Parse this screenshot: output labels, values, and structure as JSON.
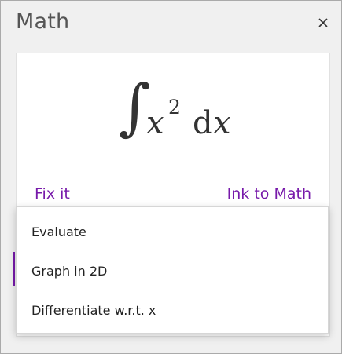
{
  "pane": {
    "title": "Math",
    "close_icon": "close-icon"
  },
  "equation": {
    "integral_sign": "∫",
    "variable": "x",
    "exponent": "2",
    "differential": "d",
    "differential_variable": "x"
  },
  "actions": {
    "fix_it": "Fix it",
    "ink_to_math": "Ink to Math"
  },
  "menu": {
    "items": [
      {
        "label": "Evaluate"
      },
      {
        "label": "Graph in 2D"
      },
      {
        "label": "Differentiate w.r.t. x"
      }
    ]
  },
  "colors": {
    "accent": "#7719aa",
    "pane_background": "#f0f0f0",
    "card_background": "#ffffff"
  }
}
